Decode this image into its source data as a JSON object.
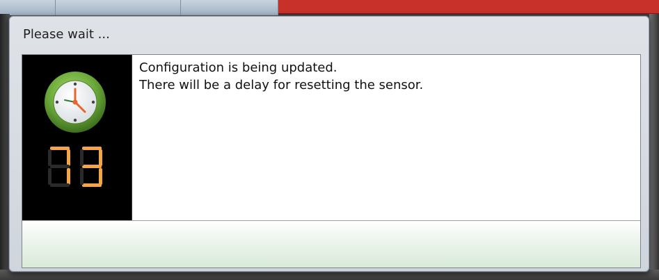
{
  "dialog": {
    "title": "Please wait ...",
    "message_lines": [
      "Configuration is being updated.",
      "There will be a delay for resetting the sensor."
    ],
    "countdown": "73"
  },
  "icons": {
    "clock": "clock-icon"
  },
  "colors": {
    "digit_on": "#f3a54a",
    "digit_off": "#2a2a2a",
    "clock_ring": "#6aa83a"
  }
}
